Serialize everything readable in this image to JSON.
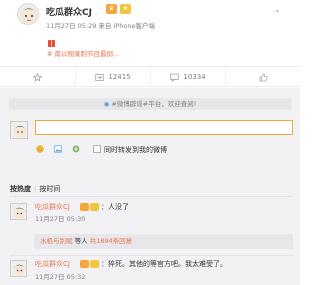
{
  "post": {
    "author": "吃瓜群众CJ",
    "date": "11月27日 05:29",
    "source_prefix": "来自",
    "source": "iPhone客户端",
    "promo_text": "✲ 南以翔录制节目最倒..."
  },
  "actions": {
    "repost_count": "12415",
    "comment_count": "10334"
  },
  "comments": {
    "topic_bar": "#微博辟谣#平台，欢迎查阅!",
    "repost_label": "同时转发到我的微博",
    "sort_hot": "按热度",
    "sort_time": "按时间",
    "items": [
      {
        "author": "吃瓜群众CJ",
        "text": "：人没了",
        "time": "11月27日 05:30"
      },
      {
        "author": "吃瓜群众CJ",
        "text": "：猝死。其他的等官方吧。我太难受了。",
        "time": "11月27日 05:32"
      }
    ],
    "reply_summary": {
      "users": "水机与别赋",
      "middle": " 等人 ",
      "count": "共1894条回复"
    }
  },
  "colors": {
    "accent": "#eb7350",
    "input_border": "#f2a53a",
    "panel_bg": "#f2f2f5"
  }
}
